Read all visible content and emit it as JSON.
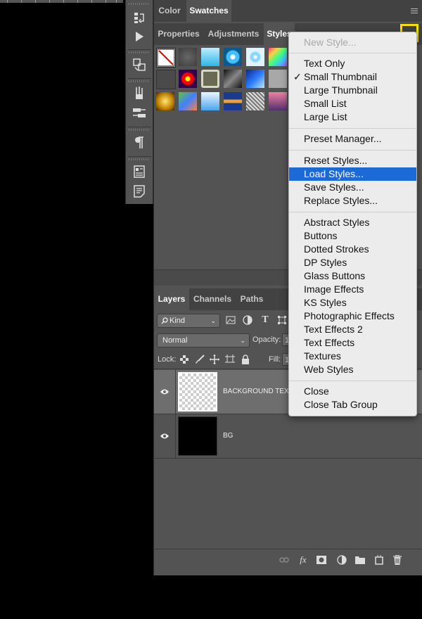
{
  "colors": {
    "accent": "#1b6ad8",
    "highlight_box": "#f5e100",
    "panel": "#535353"
  },
  "toolstrip": {
    "icons": [
      "history-icon",
      "play-action-icon",
      "clone-source-icon",
      "brush-presets-icon",
      "tool-presets-icon",
      "paragraph-icon",
      "character-styles-icon",
      "notes-icon"
    ]
  },
  "top_tabs": {
    "color": "Color",
    "swatches": "Swatches"
  },
  "style_tabs": {
    "properties": "Properties",
    "adjustments": "Adjustments",
    "styles": "Styles"
  },
  "layers_tabs": {
    "layers": "Layers",
    "channels": "Channels",
    "paths": "Paths"
  },
  "layers": {
    "filter_label": "Kind",
    "blend_mode": "Normal",
    "opacity_label": "Opacity:",
    "opacity_value": "1",
    "lock_label": "Lock:",
    "fill_label": "Fill:",
    "fill_value": "1",
    "rows": [
      {
        "name": "BACKGROUND TEX"
      },
      {
        "name": "BG"
      }
    ]
  },
  "menu": {
    "new_style": "New Style...",
    "text_only": "Text Only",
    "small_thumbnail": "Small Thumbnail",
    "large_thumbnail": "Large Thumbnail",
    "small_list": "Small List",
    "large_list": "Large List",
    "preset_manager": "Preset Manager...",
    "reset_styles": "Reset Styles...",
    "load_styles": "Load Styles...",
    "save_styles": "Save Styles...",
    "replace_styles": "Replace Styles...",
    "abstract_styles": "Abstract Styles",
    "buttons": "Buttons",
    "dotted_strokes": "Dotted Strokes",
    "dp_styles": "DP Styles",
    "glass_buttons": "Glass Buttons",
    "image_effects": "Image Effects",
    "ks_styles": "KS Styles",
    "photographic_effects": "Photographic Effects",
    "text_effects_2": "Text Effects 2",
    "text_effects": "Text Effects",
    "textures": "Textures",
    "web_styles": "Web Styles",
    "close": "Close",
    "close_tab_group": "Close Tab Group",
    "checkmark": "✓"
  }
}
